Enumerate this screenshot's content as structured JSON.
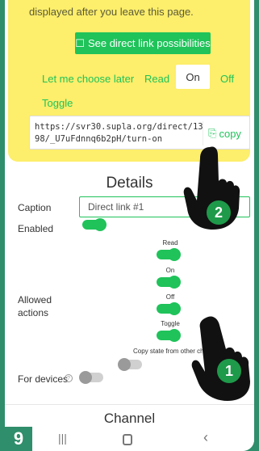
{
  "top_text": "displayed after you leave this page.",
  "see_direct_link": "See direct link possibilities",
  "actions": {
    "let_me_choose": "Let me choose later",
    "read": "Read",
    "on": "On",
    "off": "Off",
    "toggle": "Toggle"
  },
  "direct_link": {
    "url": "https://svr30.supla.org/direct/1398/_U7uFdnnq6b2pH/turn-on",
    "copy_label": "copy"
  },
  "details": {
    "title": "Details",
    "caption_label": "Caption",
    "caption_value": "Direct link #1",
    "enabled_label": "Enabled",
    "allowed_actions_label": "Allowed actions",
    "allowed": [
      {
        "label": "Read",
        "enabled": true
      },
      {
        "label": "On",
        "enabled": true
      },
      {
        "label": "Off",
        "enabled": true
      },
      {
        "label": "Toggle",
        "enabled": true
      },
      {
        "label": "Copy state from other cha",
        "enabled": false
      }
    ],
    "for_devices_label": "For devices",
    "for_devices_enabled": false
  },
  "channel_title": "Channel",
  "step_number": "9",
  "callouts": [
    "1",
    "2"
  ],
  "colors": {
    "accent": "#1fc35a",
    "yellow": "#fdee6b",
    "frame": "#2f8e6b"
  }
}
